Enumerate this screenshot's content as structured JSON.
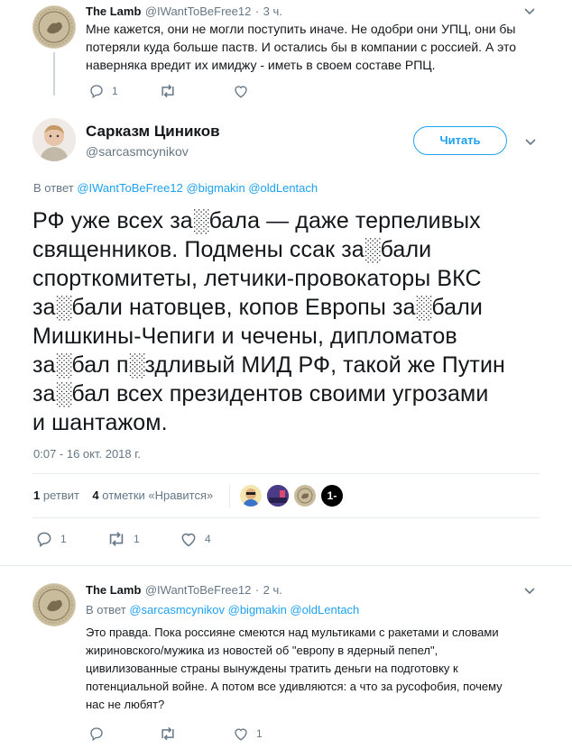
{
  "tweet1": {
    "name": "The Lamb",
    "handle": "@IWantToBeFree12",
    "time": "3 ч.",
    "text_lines": [
      "Мне кажется, они не могли поступить иначе. Не одобри они УПЦ, они бы",
      "потеряли куда больше паств. И остались бы в компании с россией. А это",
      "наверняка вредит их имиджу - иметь в своем составе РПЦ."
    ],
    "reply_count": "1",
    "retweet_count": "",
    "like_count": ""
  },
  "main": {
    "name": "Сарказм Циников",
    "handle": "@sarcasmcynikov",
    "follow_label": "Читать",
    "replying_prefix": "В ответ",
    "replying_to": [
      "@IWantToBeFree12",
      "@bigmakin",
      "@oldLentach"
    ],
    "text_lines": [
      "РФ уже всех за░бала — даже терпеливых",
      "священников. Подмены ссак за░бали",
      "спорткомитеты, летчики-провокаторы ВКС",
      "за░бали натовцев, копов Европы за░бали",
      "Мишкины-Чепиги и чечены, дипломатов",
      "за░бал п░здливый МИД РФ, такой же Путин",
      "за░бал всех президентов своими угрозами",
      "и шантажом."
    ],
    "timestamp": "0:07 - 16 окт. 2018 г.",
    "retweets_num": "1",
    "retweets_label": "ретвит",
    "likes_num": "4",
    "likes_label": "отметки «Нравится»",
    "likers_extra_icon": "1-",
    "reply_count": "1",
    "retweet_count": "1",
    "like_count": "4"
  },
  "tweet3": {
    "name": "The Lamb",
    "handle": "@IWantToBeFree12",
    "time": "2 ч.",
    "replying_prefix": "В ответ",
    "replying_to": [
      "@sarcasmcynikov",
      "@bigmakin",
      "@oldLentach"
    ],
    "text_lines": [
      "Это правда. Пока россияне смеются над мультиками с ракетами и словами",
      "жириновского/мужика из новостей об \"европу в ядерный пепел\",",
      "цивилизованные страны вынуждены тратить деньги на подготовку к",
      "потенциальной войне. А потом все удивляются: а что за русофобия, почему",
      "нас не любят?"
    ],
    "reply_count": "",
    "retweet_count": "",
    "like_count": "1"
  },
  "colors": {
    "accent": "#1da1f2",
    "muted": "#657786",
    "text": "#14171a",
    "divider": "#e6ecf0"
  },
  "icons": [
    "reply-icon",
    "retweet-icon",
    "like-icon",
    "chevron-down-icon"
  ]
}
